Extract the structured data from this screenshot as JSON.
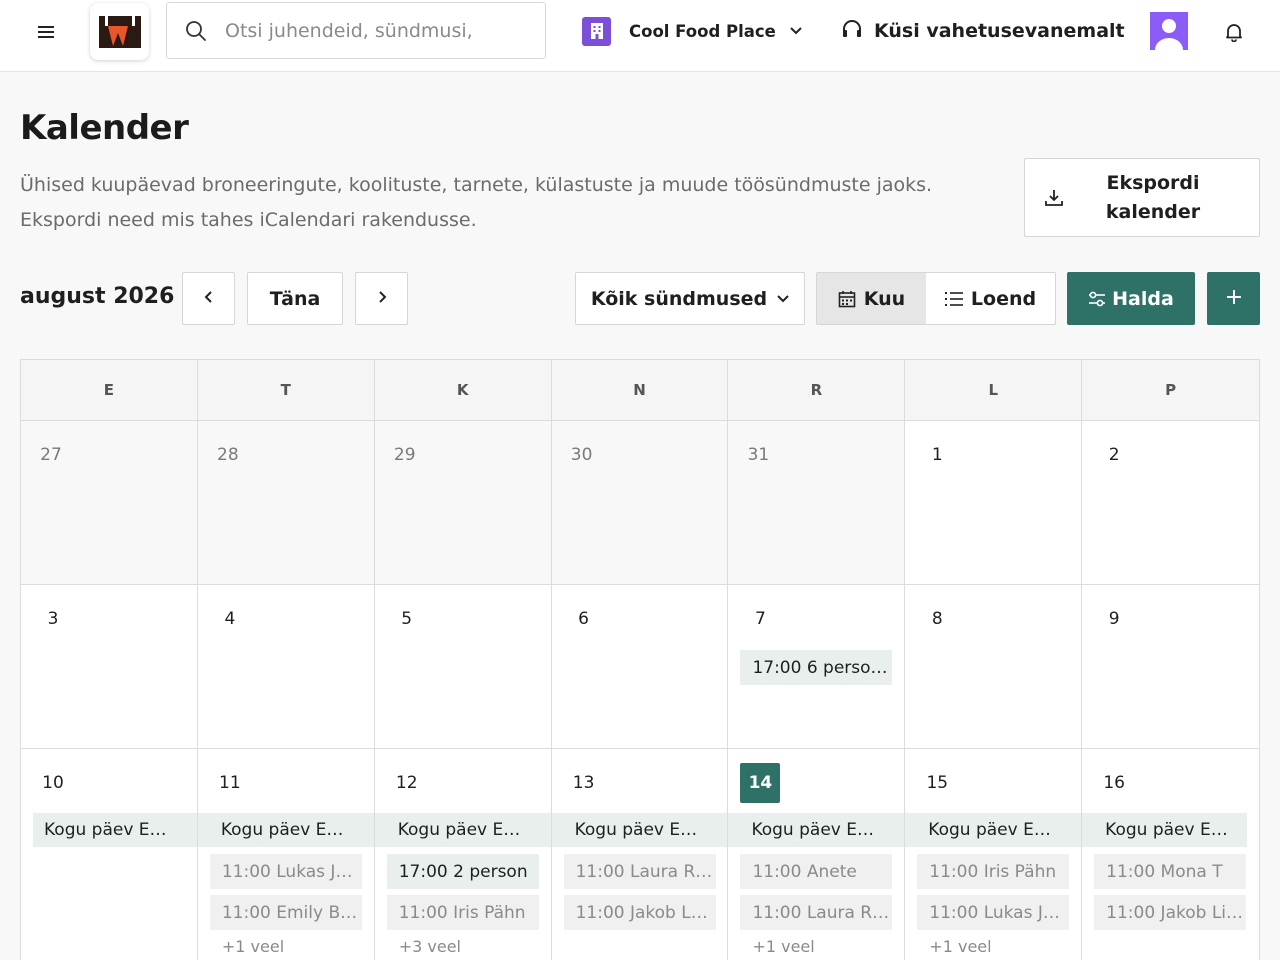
{
  "topbar": {
    "search_placeholder": "Otsi juhendeid, sündmusi,",
    "place_name": "Cool Food Place",
    "ask_label": "Küsi vahetusevanemalt"
  },
  "header": {
    "title": "Kalender",
    "description": "Ühised kuupäevad broneeringute, koolituste, tarnete, külastuste ja muude töösündmuste jaoks. Ekspordi need mis tahes iCalendari rakendusse.",
    "export_label": "Ekspordi kalender"
  },
  "toolbar": {
    "month_label": "august 2026",
    "today_label": "Täna",
    "filter_label": "Kõik sündmused",
    "view_month_label": "Kuu",
    "view_list_label": "Loend",
    "manage_label": "Halda"
  },
  "colors": {
    "accent": "#2e7267",
    "brand_purple": "#7b4fd8",
    "avatar": "#8b5cf6"
  },
  "calendar": {
    "weekdays": [
      "E",
      "T",
      "K",
      "N",
      "R",
      "L",
      "P"
    ],
    "weeks": [
      {
        "days": [
          {
            "num": "27",
            "other": true
          },
          {
            "num": "28",
            "other": true
          },
          {
            "num": "29",
            "other": true
          },
          {
            "num": "30",
            "other": true
          },
          {
            "num": "31",
            "other": true
          },
          {
            "num": "1"
          },
          {
            "num": "2"
          }
        ]
      },
      {
        "days": [
          {
            "num": "3"
          },
          {
            "num": "4"
          },
          {
            "num": "5"
          },
          {
            "num": "6"
          },
          {
            "num": "7",
            "event": "17:00 6 perso…"
          },
          {
            "num": "8"
          },
          {
            "num": "9"
          }
        ]
      },
      {
        "days": [
          {
            "num": "10",
            "allday": "Kogu päev E…"
          },
          {
            "num": "11",
            "allday": "Kogu päev E…",
            "events": [
              "11:00 Lukas J…",
              "11:00 Emily B…"
            ],
            "more": "+1 veel"
          },
          {
            "num": "12",
            "allday": "Kogu päev E…",
            "events": [
              "17:00 2 person",
              "11:00 Iris Pähn"
            ],
            "more": "+3 veel"
          },
          {
            "num": "13",
            "allday": "Kogu päev E…",
            "events": [
              "11:00 Laura R…",
              "11:00 Jakob L…"
            ]
          },
          {
            "num": "14",
            "today": true,
            "allday": "Kogu päev E…",
            "events": [
              "11:00 Anete",
              "11:00 Laura R…"
            ],
            "more": "+1 veel"
          },
          {
            "num": "15",
            "allday": "Kogu päev E…",
            "events": [
              "11:00 Iris Pähn",
              "11:00 Lukas J…"
            ],
            "more": "+1 veel"
          },
          {
            "num": "16",
            "allday": "Kogu päev E…",
            "events": [
              "11:00 Mona T",
              "11:00 Jakob Li…"
            ]
          }
        ]
      }
    ]
  }
}
